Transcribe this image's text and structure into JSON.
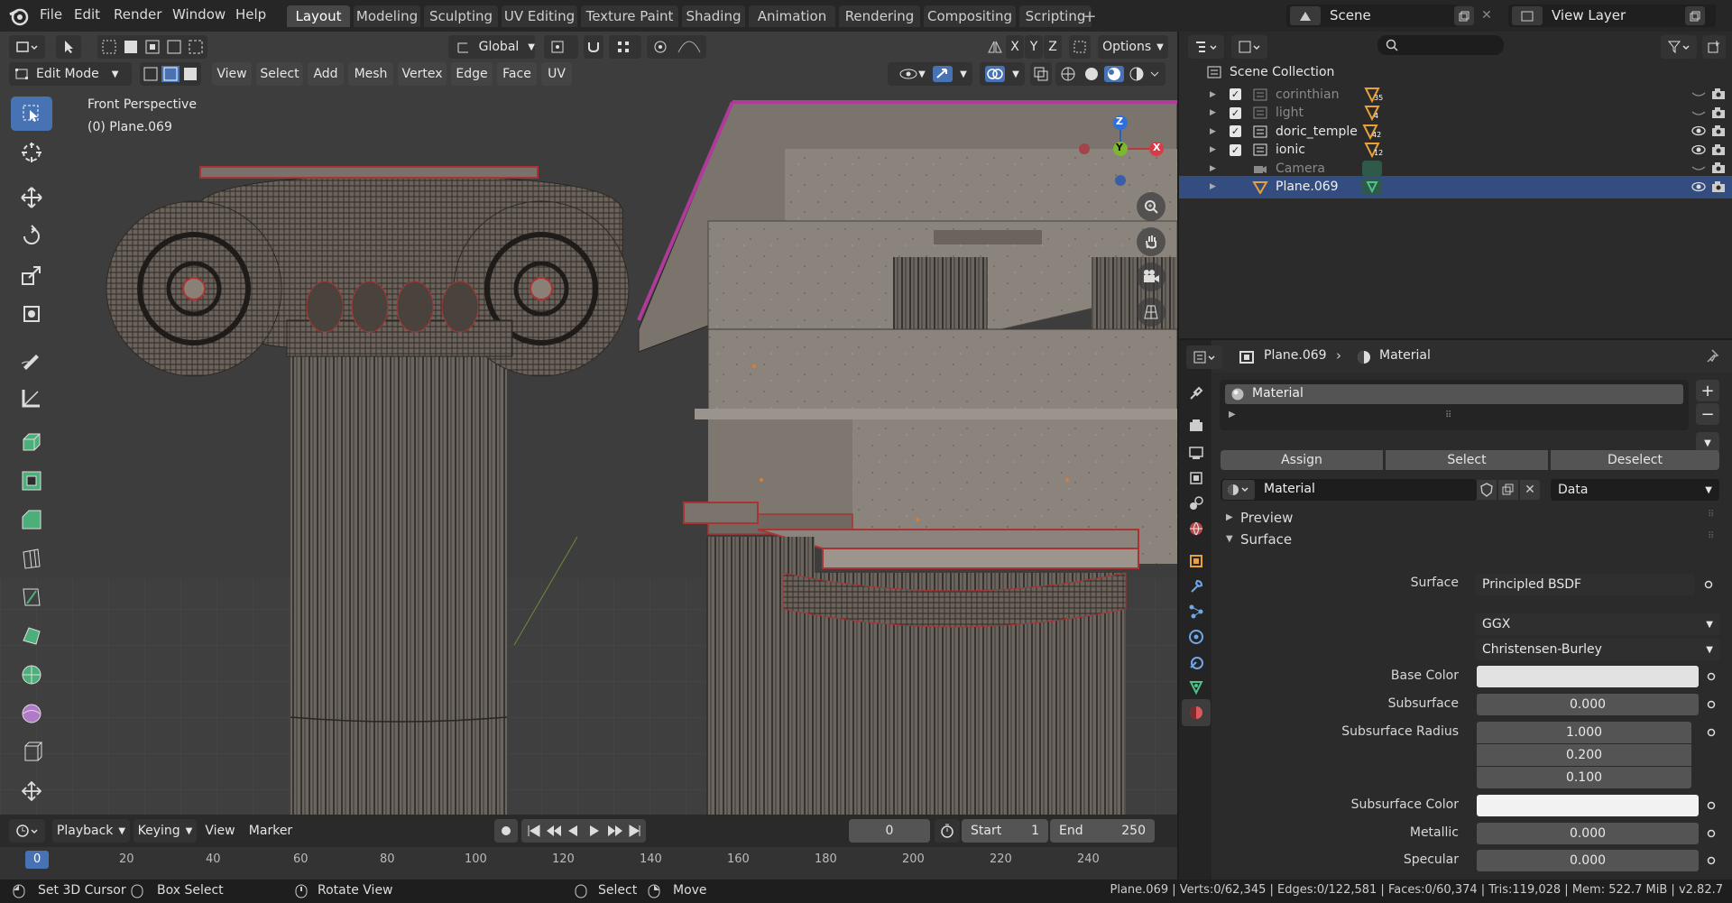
{
  "topbar": {
    "menus": [
      "File",
      "Edit",
      "Render",
      "Window",
      "Help"
    ],
    "workspaces": [
      "Layout",
      "Modeling",
      "Sculpting",
      "UV Editing",
      "Texture Paint",
      "Shading",
      "Animation",
      "Rendering",
      "Compositing",
      "Scripting"
    ],
    "active_workspace": "Layout",
    "add_tab": "+",
    "scene_label": "Scene",
    "view_layer_label": "View Layer"
  },
  "viewport": {
    "transform_orientation": "Global",
    "axes": [
      "X",
      "Y",
      "Z"
    ],
    "options_label": "Options",
    "mode": "Edit Mode",
    "menus": [
      "View",
      "Select",
      "Add",
      "Mesh",
      "Vertex",
      "Edge",
      "Face",
      "UV"
    ],
    "overlay_title": "Front Perspective",
    "overlay_object": "(0) Plane.069",
    "gizmo": {
      "z": "Z",
      "y": "Y",
      "x": "X"
    }
  },
  "toolbar": {
    "tools": [
      "select-box-icon",
      "cursor-icon",
      "move-icon",
      "rotate-icon",
      "scale-icon",
      "transform-icon",
      "annotate-icon",
      "measure-icon",
      "extrude-icon",
      "inset-icon",
      "bevel-icon",
      "loop-cut-icon",
      "knife-icon",
      "poly-build-icon",
      "spin-icon",
      "smooth-icon",
      "edge-slide-icon",
      "shrink-fatten-icon"
    ]
  },
  "timeline": {
    "menus": [
      "Playback",
      "Keying",
      "View",
      "Marker"
    ],
    "current_frame": "0",
    "start_label": "Start",
    "start": "1",
    "end_label": "End",
    "end": "250",
    "ticks": [
      "0",
      "20",
      "40",
      "60",
      "80",
      "100",
      "120",
      "140",
      "160",
      "180",
      "200",
      "220",
      "240"
    ]
  },
  "statusbar": {
    "left": [
      "Set 3D Cursor",
      "Box Select",
      "Rotate View",
      "Select",
      "Move"
    ],
    "stats": "Plane.069 | Verts:0/62,345 | Edges:0/122,581 | Faces:0/60,374 | Tris:119,028 | Mem: 522.7 MiB | v2.82.7"
  },
  "outliner": {
    "root": "Scene Collection",
    "rows": [
      {
        "name": "corinthian",
        "badge": "35",
        "dim": true
      },
      {
        "name": "light",
        "badge": "4",
        "dim": true
      },
      {
        "name": "doric_temple",
        "badge": "42",
        "dim": false
      },
      {
        "name": "ionic",
        "badge": "12",
        "dim": false
      },
      {
        "name": "Camera",
        "badge": "",
        "dim": true
      },
      {
        "name": "Plane.069",
        "badge": "",
        "dim": false,
        "selected": true
      }
    ]
  },
  "properties": {
    "breadcrumb_object": "Plane.069",
    "breadcrumb_sep": "›",
    "breadcrumb_tab": "Material",
    "slot_name": "Material",
    "add": "+",
    "remove": "−",
    "assign": "Assign",
    "select": "Select",
    "deselect": "Deselect",
    "material_name": "Material",
    "link": "Data",
    "panels": {
      "preview": "Preview",
      "surface": "Surface"
    },
    "rows": {
      "surface_label": "Surface",
      "surface_value": "Principled BSDF",
      "distribution": "GGX",
      "subsurface_method": "Christensen-Burley",
      "base_color_label": "Base Color",
      "subsurface_label": "Subsurface",
      "subsurface_value": "0.000",
      "radius_label": "Subsurface Radius",
      "radius": [
        "1.000",
        "0.200",
        "0.100"
      ],
      "subsurface_color_label": "Subsurface Color",
      "metallic_label": "Metallic",
      "metallic_value": "0.000",
      "specular_label": "Specular",
      "specular_value": "0.000"
    },
    "colors": {
      "base_color": "#e2e2e2",
      "subsurface_color": "#f2f2f2"
    }
  }
}
